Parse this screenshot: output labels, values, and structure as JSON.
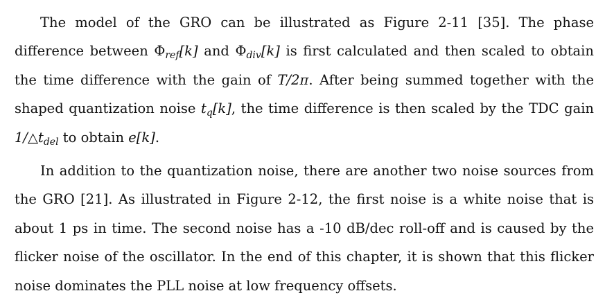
{
  "document": {
    "paragraph1": {
      "s1": "The model of the GRO can be illustrated as Figure 2-11 [35].  The phase difference between ",
      "phi_ref_sym": "Φ",
      "phi_ref_sub": "ref",
      "phi_ref_arg": "[k]",
      "s2": " and ",
      "phi_div_sym": "Φ",
      "phi_div_sub": "div",
      "phi_div_arg": "[k]",
      "s3": " is first calculated and then scaled to obtain the time difference with the gain of ",
      "gain_T": "T/2π",
      "s4": ".  After being summed together with the shaped quantization noise ",
      "tq_sym": "t",
      "tq_sub": "q",
      "tq_arg": "[k]",
      "s5": ", the time difference is then scaled by the TDC gain ",
      "tdc_gain": "1/△t",
      "tdc_sub": "del",
      "s6": " to obtain ",
      "e_k": "e[k]",
      "s7": "."
    },
    "paragraph2": "In addition to the quantization noise, there are another two noise sources from the GRO [21].  As illustrated in Figure 2-12, the first noise is a white noise that is about 1 ps in time.  The second noise has a -10 dB/dec roll-off and is caused by the flicker noise of the oscillator.  In the end of this chapter, it is shown that this flicker noise dominates the PLL noise at low frequency offsets."
  }
}
